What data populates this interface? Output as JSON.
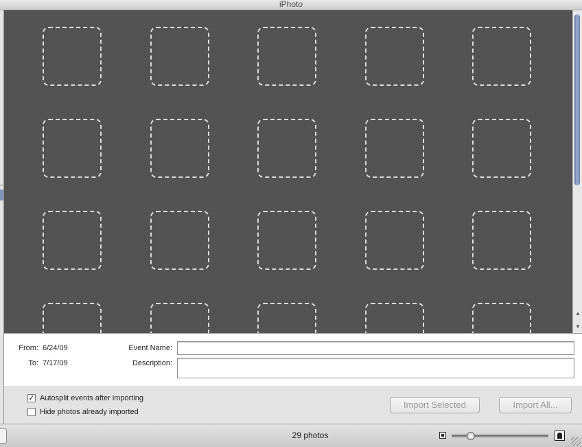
{
  "window": {
    "title": "iPhoto"
  },
  "import_grid": {
    "rows": 4,
    "columns": 5,
    "visible_placeholders": 20
  },
  "info_panel": {
    "from_label": "From:",
    "from_value": "6/24/09",
    "to_label": "To:",
    "to_value": "7/17/09",
    "event_name_label": "Event Name:",
    "event_name_value": "",
    "description_label": "Description:",
    "description_value": ""
  },
  "options": {
    "autosplit": {
      "label": "Autosplit events after importing",
      "checked": true
    },
    "hide_imported": {
      "label": "Hide photos already imported",
      "checked": false
    }
  },
  "buttons": {
    "import_selected": "Import Selected",
    "import_all": "Import All..."
  },
  "status": {
    "photo_count": "29 photos",
    "thumbnail_size_fraction": 0.2
  },
  "icons": {
    "small_thumbnail": "small-photo-icon",
    "large_thumbnail": "large-photo-icon",
    "resize": "resize-grip-icon"
  },
  "colors": {
    "grid_background": "#535353",
    "placeholder_border": "#dcdcdc",
    "scroll_thumb": "#7f93bd"
  }
}
